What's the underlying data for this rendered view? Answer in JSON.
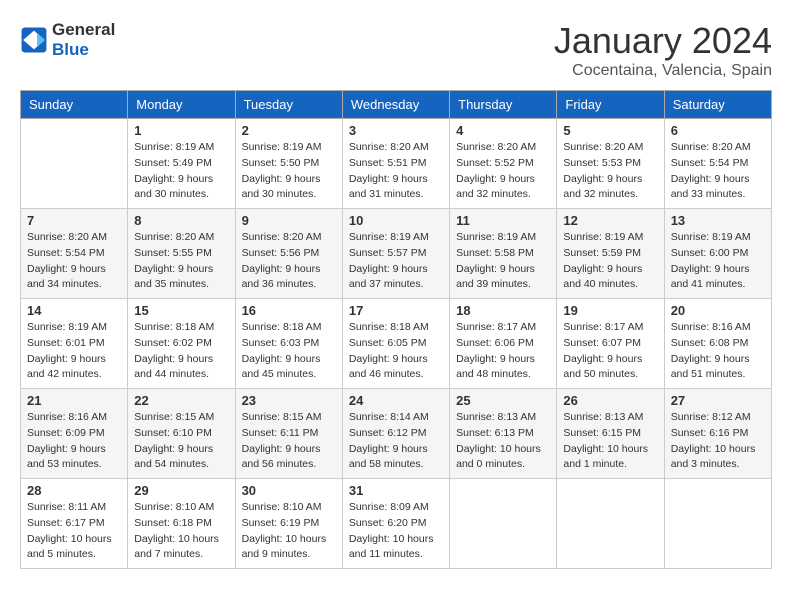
{
  "header": {
    "logo_line1": "General",
    "logo_line2": "Blue",
    "month": "January 2024",
    "location": "Cocentaina, Valencia, Spain"
  },
  "weekdays": [
    "Sunday",
    "Monday",
    "Tuesday",
    "Wednesday",
    "Thursday",
    "Friday",
    "Saturday"
  ],
  "weeks": [
    [
      {
        "day": "",
        "sunrise": "",
        "sunset": "",
        "daylight": ""
      },
      {
        "day": "1",
        "sunrise": "Sunrise: 8:19 AM",
        "sunset": "Sunset: 5:49 PM",
        "daylight": "Daylight: 9 hours and 30 minutes."
      },
      {
        "day": "2",
        "sunrise": "Sunrise: 8:19 AM",
        "sunset": "Sunset: 5:50 PM",
        "daylight": "Daylight: 9 hours and 30 minutes."
      },
      {
        "day": "3",
        "sunrise": "Sunrise: 8:20 AM",
        "sunset": "Sunset: 5:51 PM",
        "daylight": "Daylight: 9 hours and 31 minutes."
      },
      {
        "day": "4",
        "sunrise": "Sunrise: 8:20 AM",
        "sunset": "Sunset: 5:52 PM",
        "daylight": "Daylight: 9 hours and 32 minutes."
      },
      {
        "day": "5",
        "sunrise": "Sunrise: 8:20 AM",
        "sunset": "Sunset: 5:53 PM",
        "daylight": "Daylight: 9 hours and 32 minutes."
      },
      {
        "day": "6",
        "sunrise": "Sunrise: 8:20 AM",
        "sunset": "Sunset: 5:54 PM",
        "daylight": "Daylight: 9 hours and 33 minutes."
      }
    ],
    [
      {
        "day": "7",
        "sunrise": "Sunrise: 8:20 AM",
        "sunset": "Sunset: 5:54 PM",
        "daylight": "Daylight: 9 hours and 34 minutes."
      },
      {
        "day": "8",
        "sunrise": "Sunrise: 8:20 AM",
        "sunset": "Sunset: 5:55 PM",
        "daylight": "Daylight: 9 hours and 35 minutes."
      },
      {
        "day": "9",
        "sunrise": "Sunrise: 8:20 AM",
        "sunset": "Sunset: 5:56 PM",
        "daylight": "Daylight: 9 hours and 36 minutes."
      },
      {
        "day": "10",
        "sunrise": "Sunrise: 8:19 AM",
        "sunset": "Sunset: 5:57 PM",
        "daylight": "Daylight: 9 hours and 37 minutes."
      },
      {
        "day": "11",
        "sunrise": "Sunrise: 8:19 AM",
        "sunset": "Sunset: 5:58 PM",
        "daylight": "Daylight: 9 hours and 39 minutes."
      },
      {
        "day": "12",
        "sunrise": "Sunrise: 8:19 AM",
        "sunset": "Sunset: 5:59 PM",
        "daylight": "Daylight: 9 hours and 40 minutes."
      },
      {
        "day": "13",
        "sunrise": "Sunrise: 8:19 AM",
        "sunset": "Sunset: 6:00 PM",
        "daylight": "Daylight: 9 hours and 41 minutes."
      }
    ],
    [
      {
        "day": "14",
        "sunrise": "Sunrise: 8:19 AM",
        "sunset": "Sunset: 6:01 PM",
        "daylight": "Daylight: 9 hours and 42 minutes."
      },
      {
        "day": "15",
        "sunrise": "Sunrise: 8:18 AM",
        "sunset": "Sunset: 6:02 PM",
        "daylight": "Daylight: 9 hours and 44 minutes."
      },
      {
        "day": "16",
        "sunrise": "Sunrise: 8:18 AM",
        "sunset": "Sunset: 6:03 PM",
        "daylight": "Daylight: 9 hours and 45 minutes."
      },
      {
        "day": "17",
        "sunrise": "Sunrise: 8:18 AM",
        "sunset": "Sunset: 6:05 PM",
        "daylight": "Daylight: 9 hours and 46 minutes."
      },
      {
        "day": "18",
        "sunrise": "Sunrise: 8:17 AM",
        "sunset": "Sunset: 6:06 PM",
        "daylight": "Daylight: 9 hours and 48 minutes."
      },
      {
        "day": "19",
        "sunrise": "Sunrise: 8:17 AM",
        "sunset": "Sunset: 6:07 PM",
        "daylight": "Daylight: 9 hours and 50 minutes."
      },
      {
        "day": "20",
        "sunrise": "Sunrise: 8:16 AM",
        "sunset": "Sunset: 6:08 PM",
        "daylight": "Daylight: 9 hours and 51 minutes."
      }
    ],
    [
      {
        "day": "21",
        "sunrise": "Sunrise: 8:16 AM",
        "sunset": "Sunset: 6:09 PM",
        "daylight": "Daylight: 9 hours and 53 minutes."
      },
      {
        "day": "22",
        "sunrise": "Sunrise: 8:15 AM",
        "sunset": "Sunset: 6:10 PM",
        "daylight": "Daylight: 9 hours and 54 minutes."
      },
      {
        "day": "23",
        "sunrise": "Sunrise: 8:15 AM",
        "sunset": "Sunset: 6:11 PM",
        "daylight": "Daylight: 9 hours and 56 minutes."
      },
      {
        "day": "24",
        "sunrise": "Sunrise: 8:14 AM",
        "sunset": "Sunset: 6:12 PM",
        "daylight": "Daylight: 9 hours and 58 minutes."
      },
      {
        "day": "25",
        "sunrise": "Sunrise: 8:13 AM",
        "sunset": "Sunset: 6:13 PM",
        "daylight": "Daylight: 10 hours and 0 minutes."
      },
      {
        "day": "26",
        "sunrise": "Sunrise: 8:13 AM",
        "sunset": "Sunset: 6:15 PM",
        "daylight": "Daylight: 10 hours and 1 minute."
      },
      {
        "day": "27",
        "sunrise": "Sunrise: 8:12 AM",
        "sunset": "Sunset: 6:16 PM",
        "daylight": "Daylight: 10 hours and 3 minutes."
      }
    ],
    [
      {
        "day": "28",
        "sunrise": "Sunrise: 8:11 AM",
        "sunset": "Sunset: 6:17 PM",
        "daylight": "Daylight: 10 hours and 5 minutes."
      },
      {
        "day": "29",
        "sunrise": "Sunrise: 8:10 AM",
        "sunset": "Sunset: 6:18 PM",
        "daylight": "Daylight: 10 hours and 7 minutes."
      },
      {
        "day": "30",
        "sunrise": "Sunrise: 8:10 AM",
        "sunset": "Sunset: 6:19 PM",
        "daylight": "Daylight: 10 hours and 9 minutes."
      },
      {
        "day": "31",
        "sunrise": "Sunrise: 8:09 AM",
        "sunset": "Sunset: 6:20 PM",
        "daylight": "Daylight: 10 hours and 11 minutes."
      },
      {
        "day": "",
        "sunrise": "",
        "sunset": "",
        "daylight": ""
      },
      {
        "day": "",
        "sunrise": "",
        "sunset": "",
        "daylight": ""
      },
      {
        "day": "",
        "sunrise": "",
        "sunset": "",
        "daylight": ""
      }
    ]
  ]
}
